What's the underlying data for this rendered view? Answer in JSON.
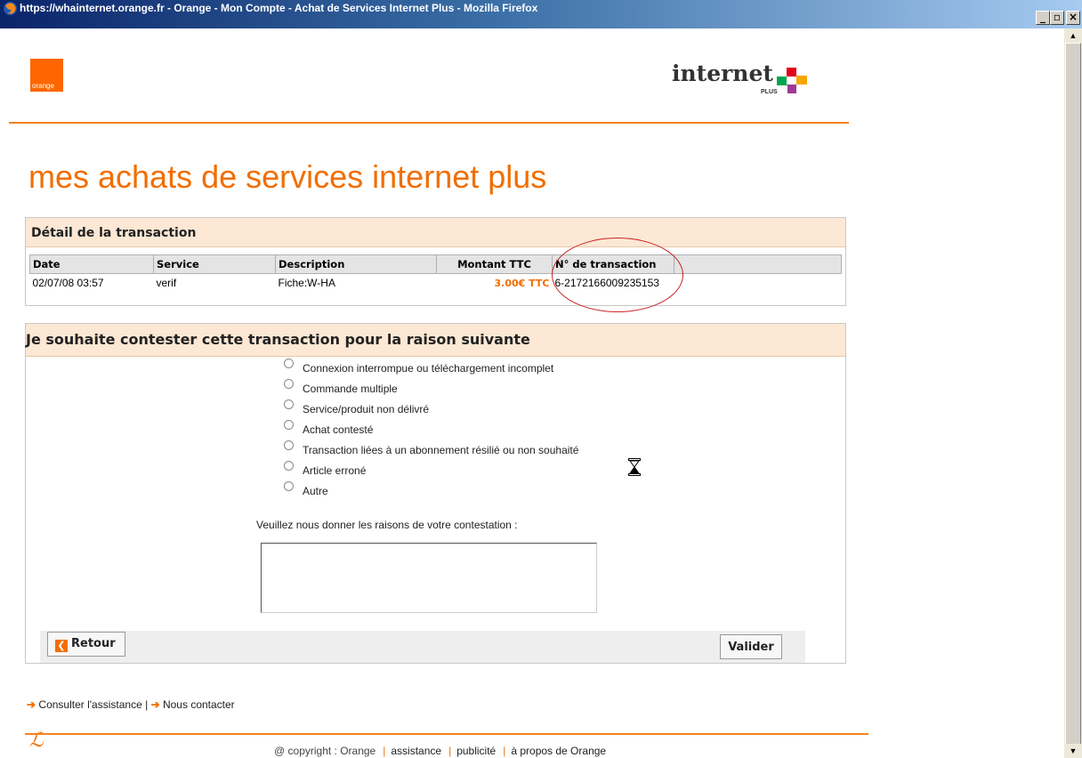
{
  "window": {
    "title": "https://whainternet.orange.fr - Orange - Mon Compte - Achat de Services Internet Plus - Mozilla Firefox"
  },
  "header": {
    "orange_logo_text": "orange",
    "internet_plus_text": "internet",
    "internet_plus_sub": "PLUS"
  },
  "page": {
    "title": "mes achats de services internet plus"
  },
  "transaction": {
    "heading": "Détail de la transaction",
    "columns": [
      "Date",
      "Service",
      "Description",
      "Montant TTC",
      "N° de transaction"
    ],
    "row": {
      "date": "02/07/08 03:57",
      "service": "verif",
      "description": "Fiche:W-HA",
      "amount": "3.00€ TTC",
      "transaction_id": "6-2172166009235153"
    }
  },
  "contest": {
    "heading": "Je souhaite contester cette transaction pour la raison suivante",
    "reasons": [
      "Connexion interrompue ou téléchargement incomplet",
      "Commande multiple",
      "Service/produit non délivré",
      "Achat contesté",
      "Transaction liées à un abonnement résilié ou non souhaité",
      "Article erroné",
      "Autre"
    ],
    "prompt": "Veuillez nous donner les raisons de votre contestation :",
    "textarea_value": "",
    "retour_label": "Retour",
    "valider_label": "Valider"
  },
  "footer": {
    "assistance": "Consulter l'assistance",
    "separator": "|",
    "contact": "Nous contacter",
    "mark": "ℒ",
    "copyright": "@ copyright : Orange",
    "link_assistance": "assistance",
    "link_publicite": "publicité",
    "link_apropos": "à propos de Orange"
  },
  "colors": {
    "brand_orange": "#f16e00",
    "panel_header": "#fce8d4",
    "titlebar": "#0a246a"
  },
  "icons": [
    "firefox-icon",
    "minimize-icon",
    "maximize-icon",
    "close-icon",
    "orange-logo",
    "internet-plus-logo",
    "hourglass-icon",
    "back-arrow-icon",
    "arrow-right-icon"
  ]
}
